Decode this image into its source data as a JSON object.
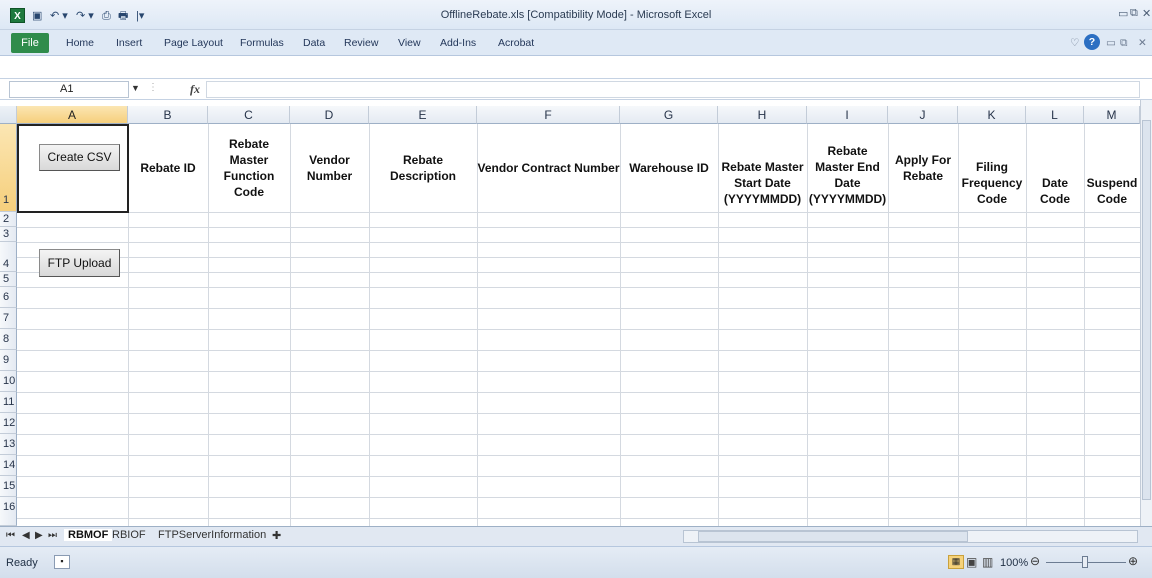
{
  "window": {
    "title": "OfflineRebate.xls  [Compatibility Mode]  -  Microsoft Excel"
  },
  "tabs": [
    "Home",
    "Insert",
    "Page Layout",
    "Formulas",
    "Data",
    "Review",
    "View",
    "Add-Ins",
    "Acrobat"
  ],
  "file_tab": "File",
  "name_box": "A1",
  "fx_label": "fx",
  "columns": [
    "A",
    "B",
    "C",
    "D",
    "E",
    "F",
    "G",
    "H",
    "I",
    "J",
    "K",
    "L",
    "M"
  ],
  "rows": [
    "1",
    "2",
    "3",
    "4",
    "5",
    "6",
    "7",
    "8",
    "9",
    "10",
    "11",
    "12",
    "13",
    "14",
    "15",
    "16"
  ],
  "headers": {
    "B": "Rebate ID",
    "C": "Rebate Master Function Code",
    "D": "Vendor Number",
    "E": "Rebate Description",
    "F": "Vendor Contract Number",
    "G": "Warehouse ID",
    "H": "Rebate Master Start Date (YYYYMMDD)",
    "I": "Rebate Master End Date (YYYYMMDD)",
    "J": "Apply For Rebate",
    "K": "Filing Frequency Code",
    "L": "Date Code",
    "M": "Suspend Code"
  },
  "buttons": {
    "create_csv": "Create CSV",
    "ftp_upload": "FTP Upload"
  },
  "sheets": [
    "RBMOF",
    "RBIOF",
    "FTPServerInformation"
  ],
  "status": {
    "ready": "Ready",
    "zoom": "100%"
  }
}
